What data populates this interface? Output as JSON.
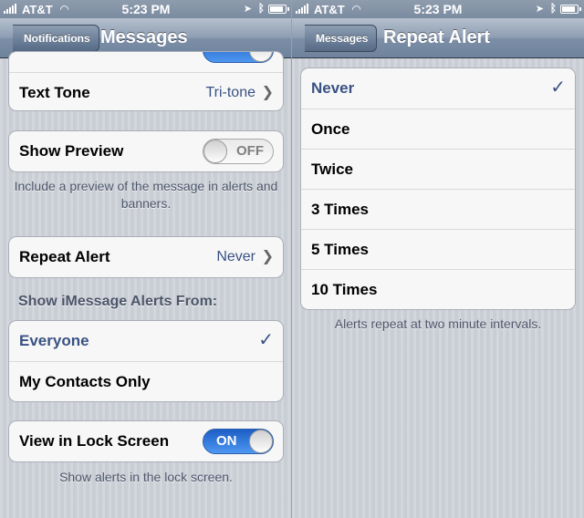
{
  "status_left": {
    "carrier": "AT&T",
    "time": "5:23 PM"
  },
  "status_right": {
    "carrier": "AT&T",
    "time": "5:23 PM"
  },
  "left": {
    "nav": {
      "back_label": "Notifications",
      "title": "Messages"
    },
    "top_group": {
      "text_tone": {
        "label": "Text Tone",
        "value": "Tri-tone"
      }
    },
    "show_preview": {
      "label": "Show Preview",
      "toggle": "OFF"
    },
    "preview_note": "Include a preview of the message in alerts and banners.",
    "repeat_alert": {
      "label": "Repeat Alert",
      "value": "Never"
    },
    "imessage_header": "Show iMessage Alerts From:",
    "imessage_options": [
      {
        "label": "Everyone",
        "selected": true
      },
      {
        "label": "My Contacts Only",
        "selected": false
      }
    ],
    "lock_screen": {
      "label": "View in Lock Screen",
      "toggle": "ON"
    },
    "lock_note": "Show alerts in the lock screen."
  },
  "right": {
    "nav": {
      "back_label": "Messages",
      "title": "Repeat Alert"
    },
    "options": [
      {
        "label": "Never",
        "selected": true
      },
      {
        "label": "Once",
        "selected": false
      },
      {
        "label": "Twice",
        "selected": false
      },
      {
        "label": "3 Times",
        "selected": false
      },
      {
        "label": "5 Times",
        "selected": false
      },
      {
        "label": "10 Times",
        "selected": false
      }
    ],
    "note": "Alerts repeat at two minute intervals."
  },
  "colors": {
    "selected_text": "#395283",
    "toggle_on": "#2f7fe6",
    "nav_bar": "#7d8fa7"
  }
}
